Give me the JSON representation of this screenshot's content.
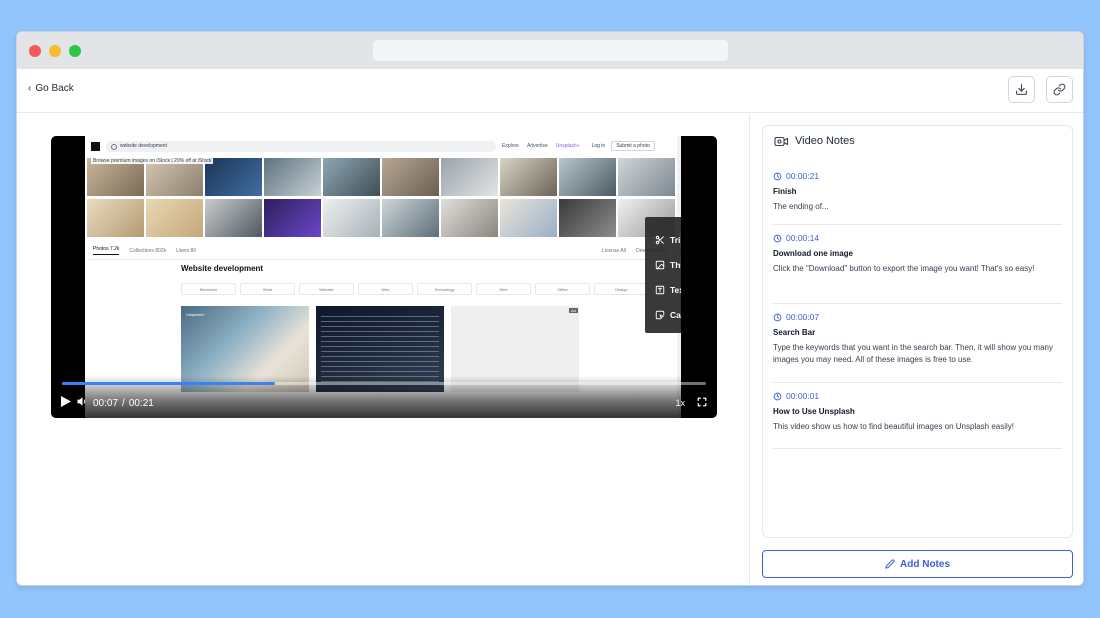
{
  "header": {
    "back_label": "Go Back"
  },
  "video": {
    "current_time": "00:07",
    "duration": "00:21",
    "time_separator": "/",
    "progress": 0.33,
    "speed": "1x",
    "accent": "#3b82f6",
    "frame": {
      "search_query": "website development",
      "nav": [
        "Explore",
        "Advertise",
        "Unsplash+"
      ],
      "login": "Log in",
      "submit": "Submit a photo",
      "banner": "Browse premium images on iStock | 20% off at iStock",
      "tabs": [
        "Photos 7.2k",
        "Collections 802k",
        "Users 80"
      ],
      "filters": [
        "License All",
        "Orientation All"
      ],
      "heading": "Website development",
      "chips": [
        "Electronic",
        "Work",
        "Website",
        "Web",
        "Technology",
        "Shirt",
        "Office",
        "Design"
      ],
      "photo_tag": "Unsplash+",
      "ad_tag": "Ad"
    },
    "menu": [
      {
        "icon": "scissors-icon",
        "label": "Trim"
      },
      {
        "icon": "image-icon",
        "label": "Thumbnail"
      },
      {
        "icon": "text-icon",
        "label": "Text"
      },
      {
        "icon": "cursor-click-icon",
        "label": "Call-to-action"
      }
    ]
  },
  "notes_panel": {
    "title": "Video Notes",
    "items": [
      {
        "time": "00:00:21",
        "title": "Finish",
        "desc": "The ending of..."
      },
      {
        "time": "00:00:14",
        "title": "Download one image",
        "desc": "Click the \"Download\" button to export the image you want! That's so easy!"
      },
      {
        "time": "00:00:07",
        "title": "Search Bar",
        "desc": "Type the keywords that you want in the search bar. Then, it will show you many images you may need. All of these images is free to use."
      },
      {
        "time": "00:00:01",
        "title": "How to Use Unsplash",
        "desc": "This video show us how to find beautiful images on Unsplash easily!"
      }
    ],
    "add_label": "Add Notes",
    "accent": "#3b5fd9"
  }
}
